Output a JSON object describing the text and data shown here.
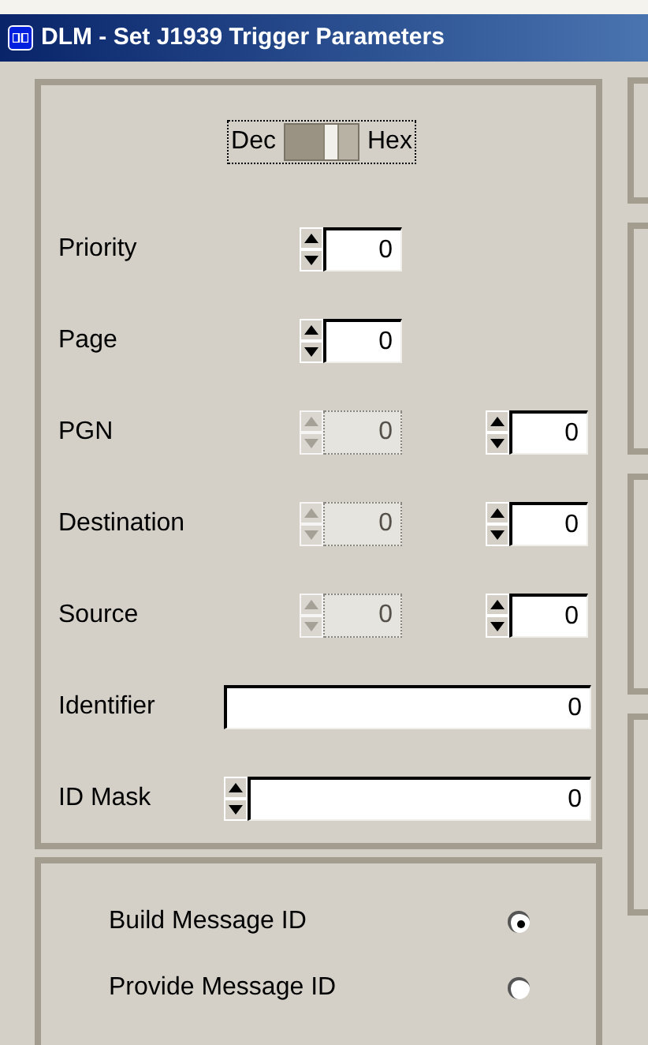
{
  "window": {
    "title": "DLM - Set J1939 Trigger Parameters"
  },
  "format_toggle": {
    "left_label": "Dec",
    "right_label": "Hex",
    "on": true
  },
  "rows": [
    {
      "label": "Priority",
      "kind": "spin",
      "fields": [
        {
          "value": "0",
          "disabled": false
        }
      ]
    },
    {
      "label": "Page",
      "kind": "spin",
      "fields": [
        {
          "value": "0",
          "disabled": false
        }
      ]
    },
    {
      "label": "PGN",
      "kind": "spin",
      "fields": [
        {
          "value": "0",
          "disabled": true
        },
        {
          "value": "0",
          "disabled": false
        }
      ]
    },
    {
      "label": "Destination",
      "kind": "spin",
      "fields": [
        {
          "value": "0",
          "disabled": true
        },
        {
          "value": "0",
          "disabled": false
        }
      ]
    },
    {
      "label": "Source",
      "kind": "spin",
      "fields": [
        {
          "value": "0",
          "disabled": true
        },
        {
          "value": "0",
          "disabled": false
        }
      ]
    },
    {
      "label": "Identifier",
      "kind": "text",
      "fields": [
        {
          "value": "0",
          "disabled": false
        }
      ]
    },
    {
      "label": "ID Mask",
      "kind": "wide-spin",
      "fields": [
        {
          "value": "0",
          "disabled": false
        }
      ]
    }
  ],
  "id_mode": [
    {
      "label": "Build Message ID",
      "selected": true
    },
    {
      "label": "Provide Message ID",
      "selected": false
    }
  ]
}
